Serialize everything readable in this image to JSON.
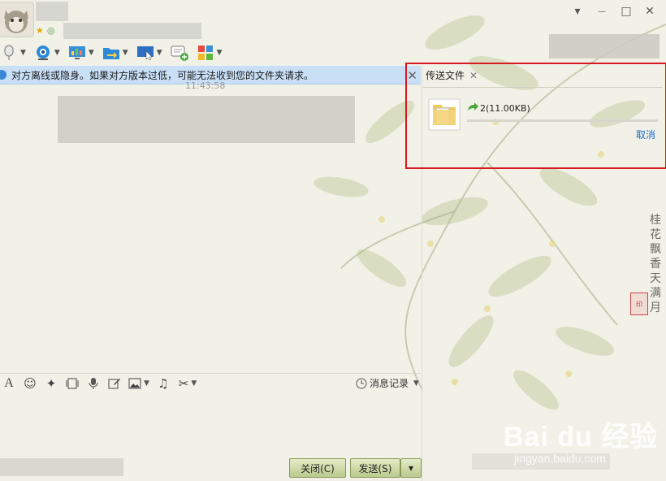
{
  "window": {
    "controls": {
      "menu": "▾",
      "minimize": "—",
      "maximize": "□",
      "close": "✕"
    }
  },
  "toolbar": {
    "icons": [
      "microphone-icon",
      "webcam-icon",
      "screen-share-icon",
      "folder-transfer-icon",
      "remote-desktop-icon",
      "group-chat-icon",
      "apps-icon"
    ]
  },
  "notice": {
    "text": "对方离线或隐身。如果对方版本过低，可能无法收到您的文件夹请求。",
    "close": "✕"
  },
  "chat": {
    "timestamp": "11:43:58"
  },
  "file_panel": {
    "tab_label": "传送文件",
    "tab_close": "✕",
    "file_name": "2(11.00KB)",
    "progress": 0,
    "cancel_label": "取消"
  },
  "input_toolbar": {
    "font_glyph": "A",
    "history_label": "消息记录"
  },
  "buttons": {
    "close_label": "关闭(C)",
    "send_label": "发送(S)",
    "send_options": "▾"
  },
  "decor": {
    "poem": "桂花飘香天满月",
    "seal": "印",
    "watermark": "Bai du 经验",
    "watermark_url": "jingyan.baidu.com"
  },
  "colors": {
    "notice_bg": "#c8dff6",
    "highlight_frame": "#d8191f",
    "link": "#1e6cc7",
    "button": "#bcc98e"
  }
}
